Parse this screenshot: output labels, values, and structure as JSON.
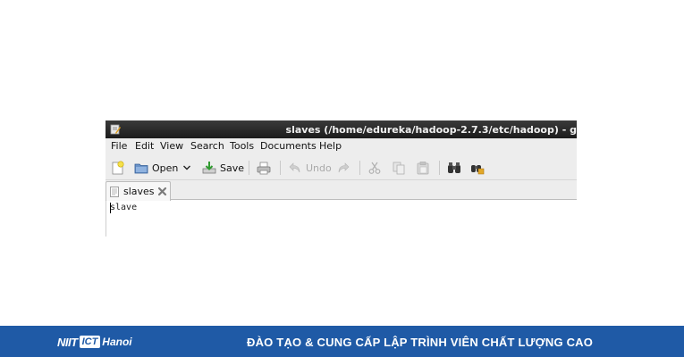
{
  "window": {
    "title": "slaves (/home/edureka/hadoop-2.7.3/etc/hadoop) - g"
  },
  "menubar": {
    "items": [
      "File",
      "Edit",
      "View",
      "Search",
      "Tools",
      "Documents",
      "Help"
    ]
  },
  "toolbar": {
    "open_label": "Open",
    "save_label": "Save",
    "undo_label": "Undo"
  },
  "tabs": [
    {
      "label": "slaves"
    }
  ],
  "editor": {
    "content": "slave"
  },
  "banner": {
    "logo_part1": "NIIT",
    "logo_part2": "ICT",
    "logo_part3": "Hanoi",
    "slogan": "ĐÀO TẠO & CUNG CẤP LẬP TRÌNH VIÊN CHẤT LƯỢNG CAO",
    "background_color": "#1f5aa6"
  }
}
